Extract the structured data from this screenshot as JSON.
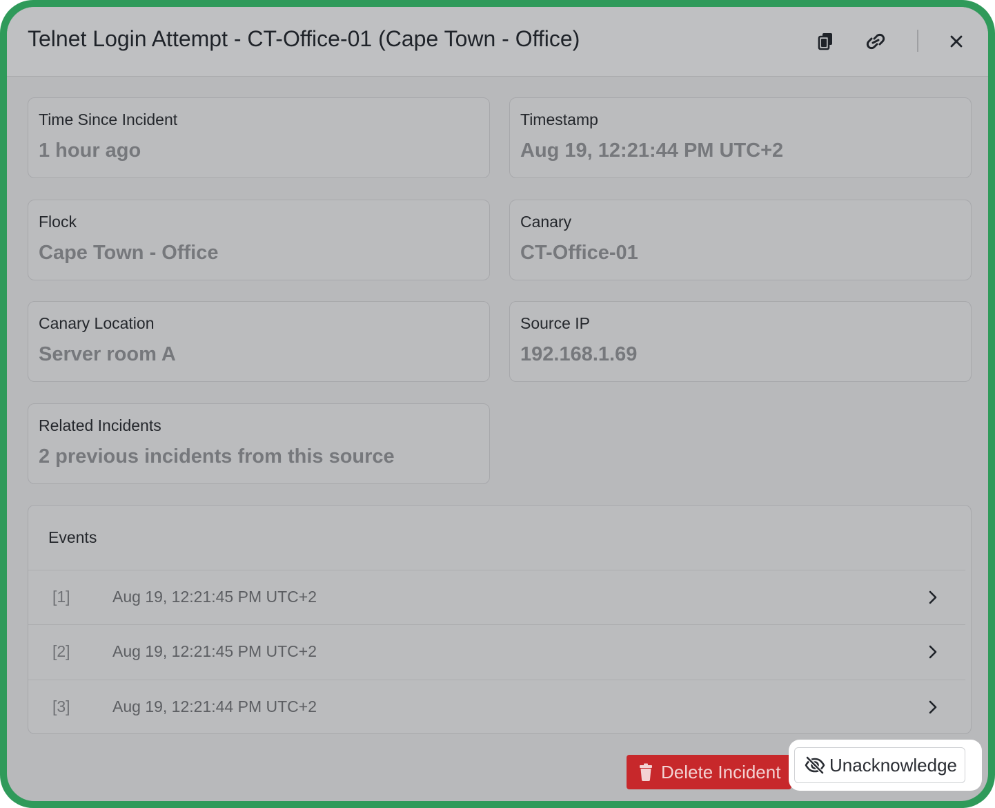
{
  "modal": {
    "title": "Telnet Login Attempt - CT-Office-01 (Cape Town - Office)",
    "header_icons": [
      "copy-icon",
      "link-icon",
      "close-icon"
    ]
  },
  "fields": {
    "time_since": {
      "label": "Time Since Incident",
      "value": "1 hour ago"
    },
    "timestamp": {
      "label": "Timestamp",
      "value": "Aug 19, 12:21:44 PM UTC+2"
    },
    "flock": {
      "label": "Flock",
      "value": "Cape Town - Office"
    },
    "canary": {
      "label": "Canary",
      "value": "CT-Office-01"
    },
    "canary_location": {
      "label": "Canary Location",
      "value": "Server room A"
    },
    "source_ip": {
      "label": "Source IP",
      "value": "192.168.1.69"
    },
    "related": {
      "label": "Related Incidents",
      "value": "2 previous incidents from this source"
    }
  },
  "events": {
    "title": "Events",
    "rows": [
      {
        "index": "[1]",
        "time": "Aug 19, 12:21:45 PM UTC+2"
      },
      {
        "index": "[2]",
        "time": "Aug 19, 12:21:45 PM UTC+2"
      },
      {
        "index": "[3]",
        "time": "Aug 19, 12:21:44 PM UTC+2"
      }
    ]
  },
  "actions": {
    "delete_label": "Delete Incident",
    "unack_label": "Unacknowledge"
  },
  "colors": {
    "frame_accent": "#2f9a5a",
    "danger": "#c7282b",
    "overlay_gray": "#b8b9bb"
  }
}
